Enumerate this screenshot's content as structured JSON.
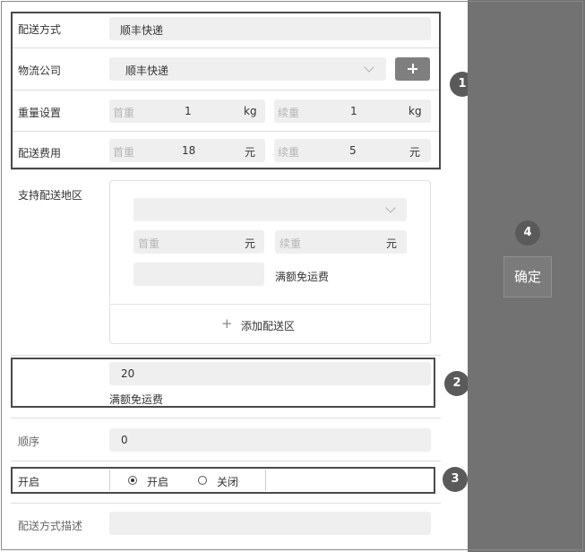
{
  "form": {
    "method": {
      "label": "配送方式",
      "value": "顺丰快递"
    },
    "company": {
      "label": "物流公司",
      "value": "顺丰快递"
    },
    "weight": {
      "label": "重量设置",
      "first_label": "首重",
      "first_value": "1",
      "first_unit": "kg",
      "next_label": "续重",
      "next_value": "1",
      "next_unit": "kg"
    },
    "fee": {
      "label": "配送费用",
      "first_label": "首重",
      "first_value": "18",
      "first_unit": "元",
      "next_label": "续重",
      "next_value": "5",
      "next_unit": "元"
    },
    "region": {
      "label": "支持配送地区",
      "first_placeholder": "首重",
      "first_unit": "元",
      "next_placeholder": "续重",
      "next_unit": "元",
      "free_label": "满额免运费",
      "add_label": "添加配送区"
    },
    "free_shipping": {
      "value": "20",
      "caption": "满额免运费"
    },
    "order": {
      "label": "顺序",
      "value": "0"
    },
    "enable": {
      "label": "开启",
      "on_label": "开启",
      "off_label": "关闭",
      "selected": "开启"
    },
    "description": {
      "label": "配送方式描述",
      "value": ""
    }
  },
  "annotations": [
    "1",
    "2",
    "3",
    "4"
  ],
  "side": {
    "confirm_label": "确定"
  }
}
